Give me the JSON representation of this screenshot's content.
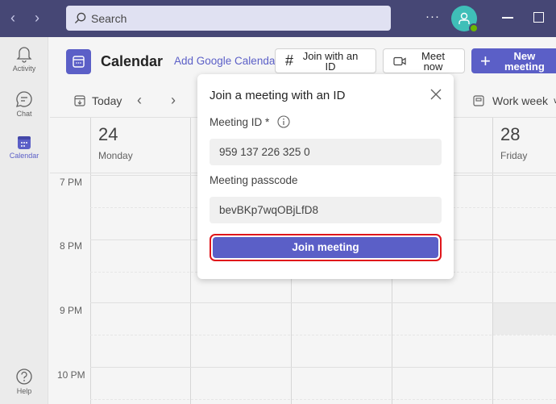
{
  "titlebar": {
    "search_placeholder": "Search",
    "more_label": "···"
  },
  "rail": {
    "items": [
      {
        "label": "Activity",
        "icon": "bell-icon"
      },
      {
        "label": "Chat",
        "icon": "chat-icon"
      },
      {
        "label": "Calendar",
        "icon": "calendar-icon",
        "active": true
      },
      {
        "label": "Help",
        "icon": "help-icon"
      }
    ]
  },
  "header": {
    "title": "Calendar",
    "add_google": "Add Google Calendar",
    "join_id_label": "Join with an ID",
    "meet_now_label": "Meet now",
    "new_meeting_label": "New meeting"
  },
  "toolbar": {
    "today_label": "Today",
    "view_label": "Work week"
  },
  "calendar": {
    "days": [
      {
        "num": "24",
        "name": "Monday"
      },
      {
        "num": "28",
        "name": "Friday"
      }
    ],
    "times": [
      "7 PM",
      "8 PM",
      "9 PM",
      "10 PM"
    ]
  },
  "dialog": {
    "title": "Join a meeting with an ID",
    "meeting_id_label": "Meeting ID *",
    "meeting_id_value": "959 137 226 325 0",
    "passcode_label": "Meeting passcode",
    "passcode_value": "bevBKp7wqOBjLfD8",
    "join_button": "Join meeting"
  },
  "colors": {
    "brand": "#5b5fc7",
    "titlebar": "#464775",
    "highlight": "#e0161b"
  }
}
